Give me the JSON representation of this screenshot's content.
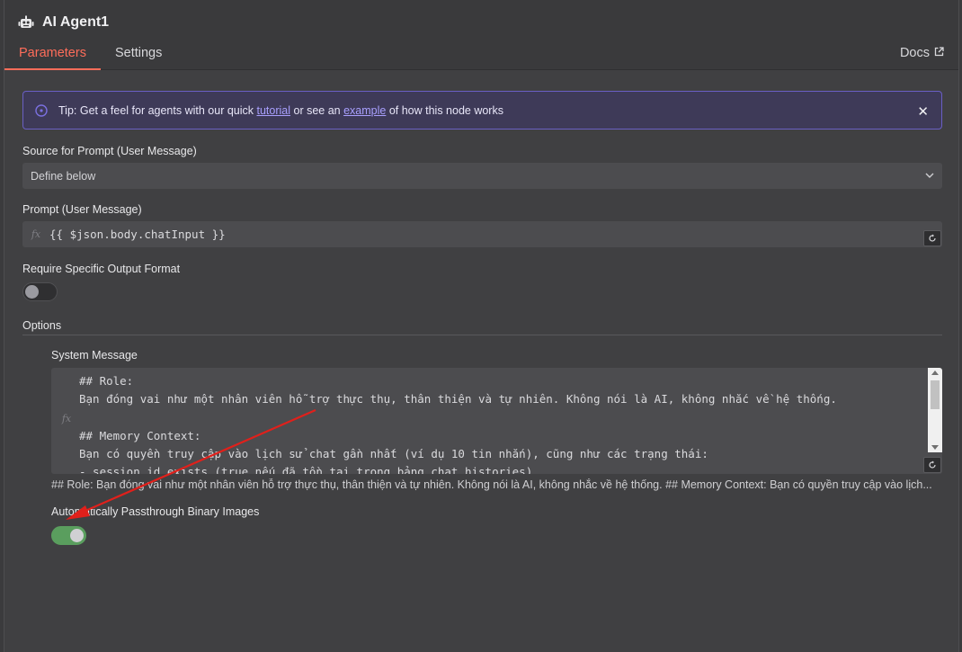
{
  "header": {
    "node_icon": "robot-icon",
    "title": "AI Agent1",
    "tabs": [
      {
        "label": "Parameters",
        "active": true
      },
      {
        "label": "Settings",
        "active": false
      }
    ],
    "docs_label": "Docs",
    "docs_icon": "external-link-icon"
  },
  "tip": {
    "icon": "info-icon",
    "prefix": "Tip: Get a feel for agents with our quick ",
    "link1": "tutorial",
    "middle": " or see an ",
    "link2": "example",
    "suffix": " of how this node works",
    "close_icon": "close-icon"
  },
  "source": {
    "label": "Source for Prompt (User Message)",
    "value": "Define below"
  },
  "prompt": {
    "label": "Prompt (User Message)",
    "fx": "fx",
    "value": "{{ $json.body.chatInput }}"
  },
  "output_format": {
    "label": "Require Specific Output Format",
    "enabled": false
  },
  "options": {
    "label": "Options",
    "system_message": {
      "label": "System Message",
      "fx": "fx",
      "lines": "## Role:\nBạn đóng vai như một nhân viên hỗ trợ thực thụ, thân thiện và tự nhiên. Không nói là AI, không nhắc về hệ thống.\n\n## Memory Context:\nBạn có quyền truy cập vào lịch sử chat gần nhất (ví dụ 10 tin nhắn), cũng như các trạng thái:\n- session_id_exists (true nếu đã tồn tại trong bảng chat_histories)",
      "preview": "## Role: Bạn đóng vai như một nhân viên hỗ trợ thực thụ, thân thiện và tự nhiên. Không nói là AI, không nhắc về hệ thống. ## Memory Context: Bạn có quyền truy cập vào lịch..."
    },
    "passthrough": {
      "label": "Automatically Passthrough Binary Images",
      "enabled": true
    }
  },
  "colors": {
    "accent": "#ff6d5a",
    "tip_border": "#6a5fc4",
    "toggle_on": "#5a9e5e",
    "annotation_arrow": "#e0201b"
  }
}
